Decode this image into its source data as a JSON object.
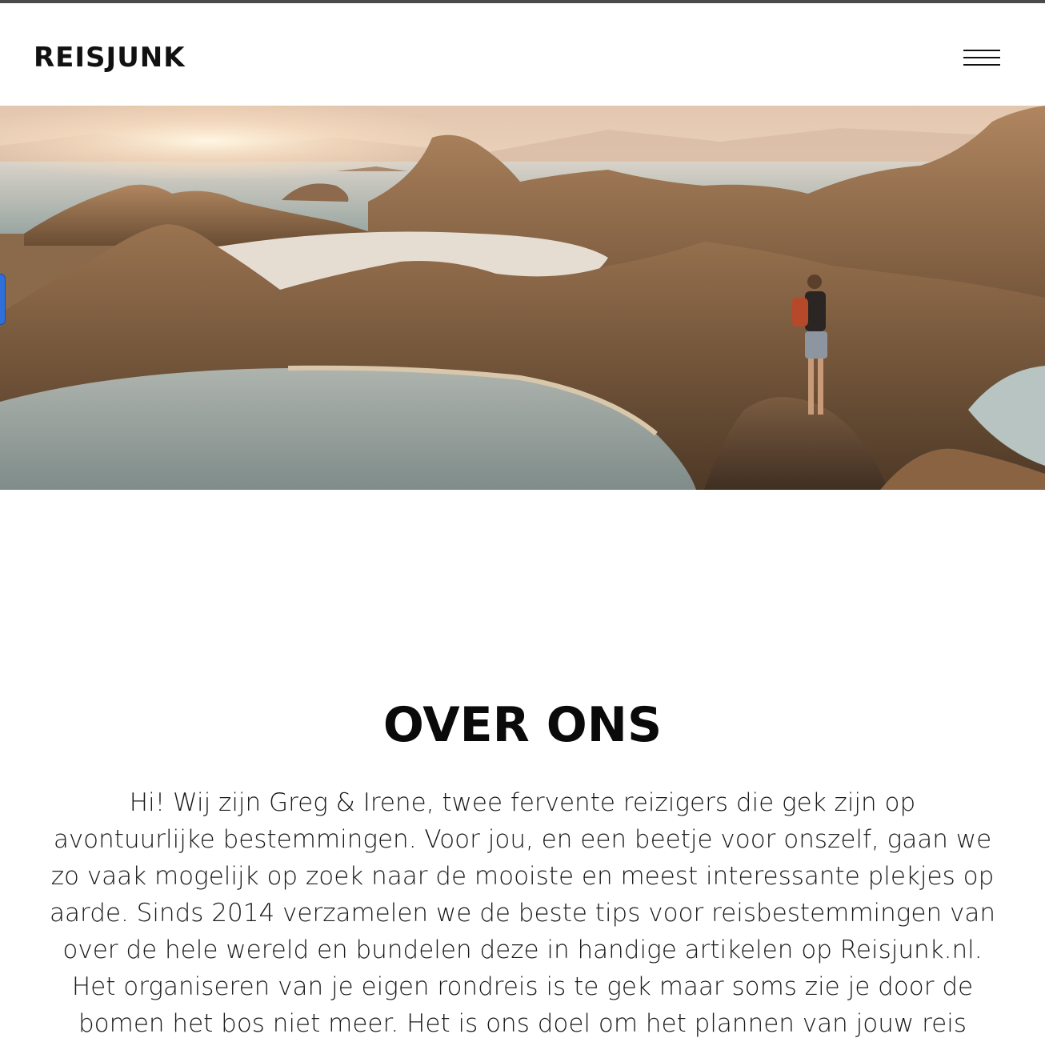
{
  "header": {
    "logo_text": "REISJUNK",
    "menu_icon": "hamburger-menu-icon"
  },
  "hero": {
    "image_subject": "landscape-photo",
    "colors": {
      "sky": "#e9d2bd",
      "sun": "#fff3dc",
      "water": "#c8ccc8",
      "hills": "#7a5a3c"
    }
  },
  "about": {
    "title": "OVER ONS",
    "lines": [
      "Hi! Wij zijn Greg & Irene, twee fervente reizigers die gek zijn op",
      "avontuurlijke bestemmingen. Voor jou, en een beetje voor onszelf, gaan we",
      "zo vaak mogelijk op zoek naar de mooiste en meest interessante plekjes op",
      "aarde. Sinds 2014 verzamelen we de beste tips voor reisbestemmingen van",
      "over de hele wereld en bundelen deze in handige artikelen op Reisjunk.nl.",
      "Het organiseren van je eigen rondreis is te gek maar soms zie je door de",
      "bomen het bos niet meer. Het is ons doel om het plannen van jouw reis"
    ]
  }
}
